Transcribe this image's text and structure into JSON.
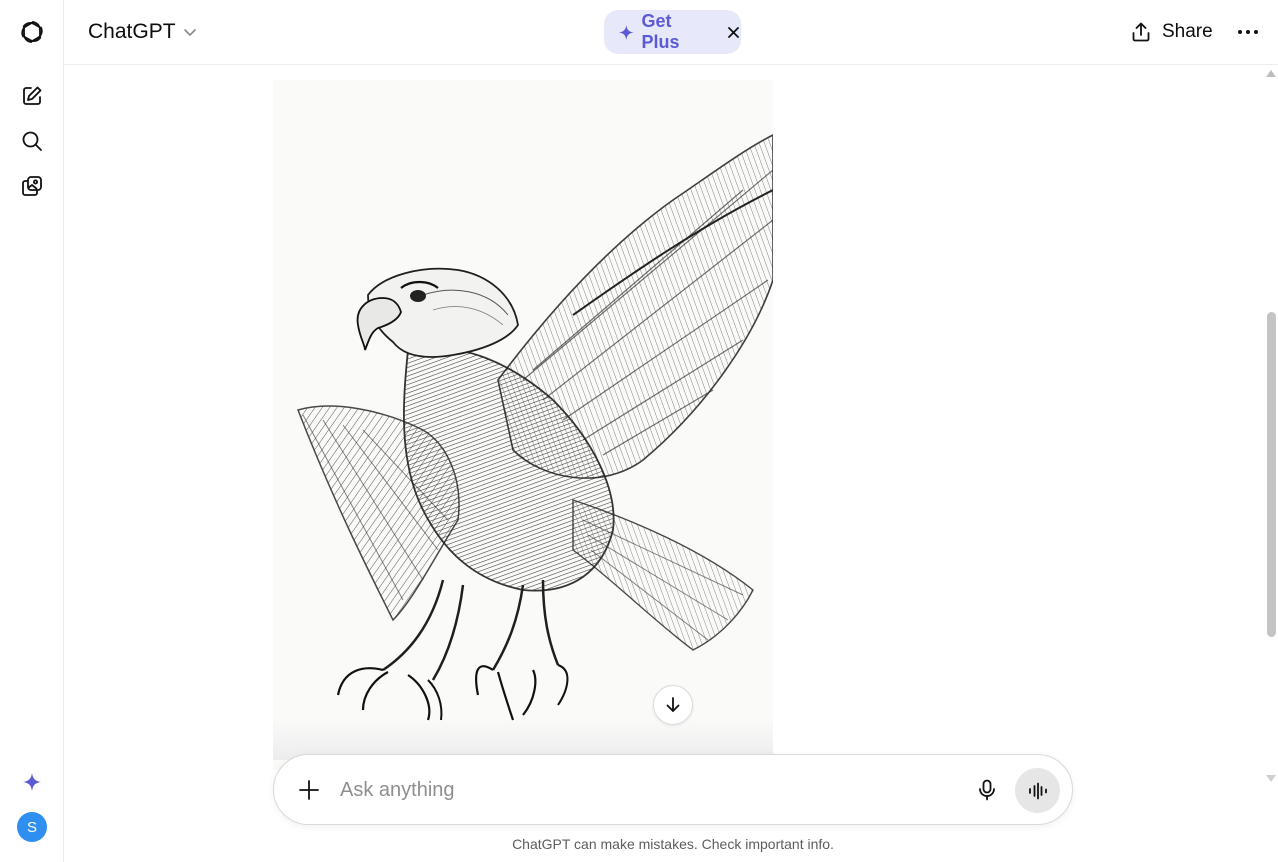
{
  "sidebar": {
    "items": [
      {
        "name": "openai-logo-icon"
      },
      {
        "name": "new-chat-icon"
      },
      {
        "name": "search-icon"
      },
      {
        "name": "library-icon"
      }
    ],
    "upgrade_icon": "sparkle-icon",
    "avatar_initial": "S",
    "avatar_color": "#2f8ff0"
  },
  "header": {
    "model_label": "ChatGPT",
    "get_plus_label": "Get Plus",
    "get_plus_close": "×",
    "share_label": "Share",
    "accent_color": "#5b5bd6"
  },
  "main": {
    "image_subject": "pencil-sketch-eagle"
  },
  "composer": {
    "placeholder": "Ask anything",
    "value": ""
  },
  "footer": {
    "disclaimer": "ChatGPT can make mistakes. Check important info."
  }
}
